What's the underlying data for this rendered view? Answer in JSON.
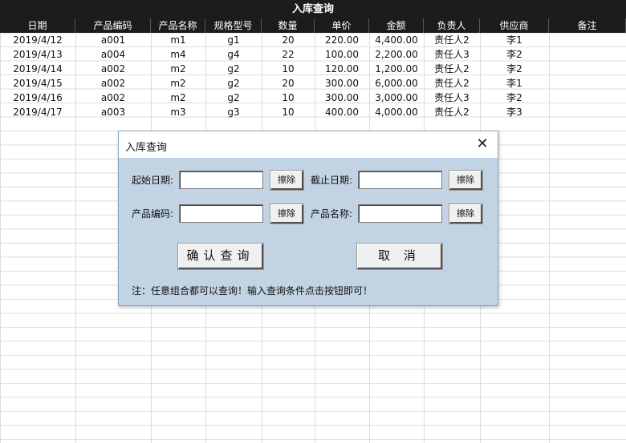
{
  "title": "入库查询",
  "columns": [
    "日期",
    "产品编码",
    "产品名称",
    "规格型号",
    "数量",
    "单价",
    "金额",
    "负责人",
    "供应商",
    "备注"
  ],
  "rows": [
    [
      "2019/4/12",
      "a001",
      "m1",
      "g1",
      "20",
      "220.00",
      "4,400.00",
      "责任人2",
      "李1",
      ""
    ],
    [
      "2019/4/13",
      "a004",
      "m4",
      "g4",
      "22",
      "100.00",
      "2,200.00",
      "责任人3",
      "李2",
      ""
    ],
    [
      "2019/4/14",
      "a002",
      "m2",
      "g2",
      "10",
      "120.00",
      "1,200.00",
      "责任人2",
      "李2",
      ""
    ],
    [
      "2019/4/15",
      "a002",
      "m2",
      "g2",
      "20",
      "300.00",
      "6,000.00",
      "责任人2",
      "李1",
      ""
    ],
    [
      "2019/4/16",
      "a002",
      "m2",
      "g2",
      "10",
      "300.00",
      "3,000.00",
      "责任人3",
      "李2",
      ""
    ],
    [
      "2019/4/17",
      "a003",
      "m3",
      "g3",
      "10",
      "400.00",
      "4,000.00",
      "责任人2",
      "李3",
      ""
    ]
  ],
  "dialog": {
    "title": "入库查询",
    "close_symbol": "✕",
    "start_date_label": "起始日期:",
    "end_date_label": "截止日期:",
    "product_code_label": "产品编码:",
    "product_name_label": "产品名称:",
    "start_date_value": "",
    "end_date_value": "",
    "product_code_value": "",
    "product_name_value": "",
    "clear_label": "擦除",
    "confirm_label": "确认查询",
    "cancel_label": "取 消",
    "note": "注：任意组合都可以查询！输入查询条件点击按钮即可！"
  }
}
